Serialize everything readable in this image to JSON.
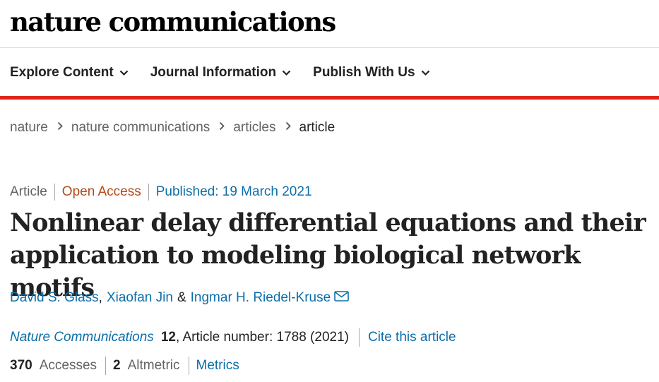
{
  "site": {
    "logo_text": "nature communications"
  },
  "nav": {
    "items": [
      {
        "label": "Explore Content"
      },
      {
        "label": "Journal Information"
      },
      {
        "label": "Publish With Us"
      }
    ]
  },
  "breadcrumb": {
    "items": [
      "nature",
      "nature communications",
      "articles"
    ],
    "current": "article"
  },
  "article": {
    "type": "Article",
    "access": "Open Access",
    "published": "Published: 19 March 2021",
    "title": "Nonlinear delay differential equations and their application to modeling biological network motifs",
    "authors": [
      "David S. Glass",
      "Xiaofan Jin",
      "Ingmar H. Riedel-Kruse"
    ],
    "author_sep_comma": ",",
    "author_sep_amp": "&",
    "journal_name": "Nature Communications",
    "volume": "12",
    "article_number_text": ", Article number: 1788 (2021)",
    "cite_label": "Cite this article",
    "accesses_count": "370",
    "accesses_label": "Accesses",
    "altmetric_count": "2",
    "altmetric_label": "Altmetric",
    "metrics_label": "Metrics"
  },
  "colors": {
    "brand_red": "#e1251b",
    "link_blue": "#0c6ea9",
    "open_access": "#b34b17"
  },
  "icons": {
    "nav_chevron": "chevron-down-icon",
    "crumb_separator": "chevron-right-icon",
    "corresponding_author": "envelope-icon"
  }
}
